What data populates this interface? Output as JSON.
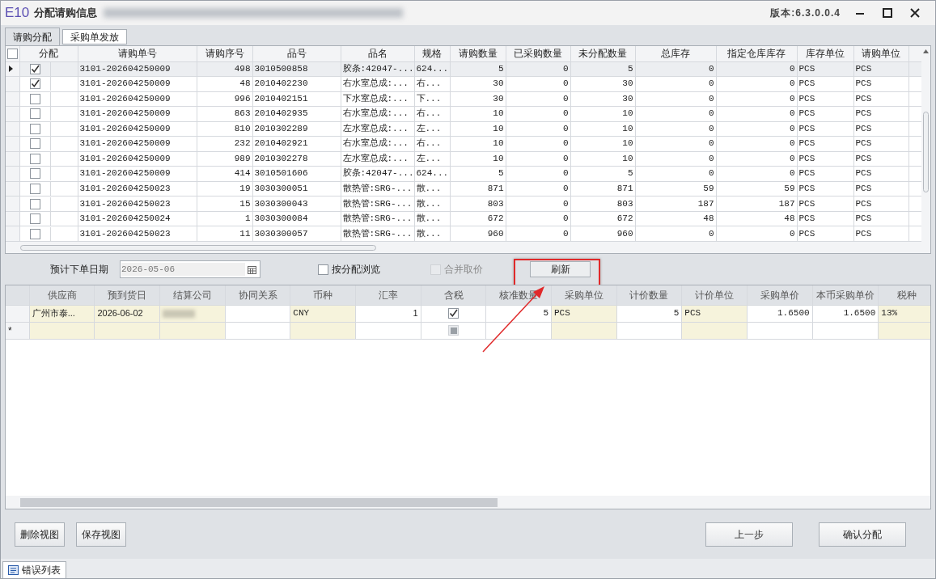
{
  "window": {
    "logo": "E10",
    "title": "分配请购信息",
    "version": "版本:6.3.0.0.4"
  },
  "tabs": [
    {
      "label": "请购分配",
      "selected": true
    },
    {
      "label": "采购单发放",
      "selected": false
    }
  ],
  "allocation_table": {
    "select_all_checked": false,
    "allocation_column": "分配",
    "columns": [
      "请购单号",
      "请购序号",
      "品号",
      "品名",
      "规格",
      "请购数量",
      "已采购数量",
      "未分配数量",
      "总库存",
      "指定仓库库存",
      "库存单位",
      "请购单位"
    ],
    "rows": [
      {
        "selected": true,
        "checked": true,
        "cells": [
          "3101-202604250009",
          "498",
          "3010500858",
          "胶条:42047-...",
          "624...",
          "5",
          "0",
          "5",
          "0",
          "0",
          "PCS",
          "PCS"
        ]
      },
      {
        "selected": false,
        "checked": true,
        "cells": [
          "3101-202604250009",
          "48",
          "2010402230",
          "右水室总成:...",
          "右...",
          "30",
          "0",
          "30",
          "0",
          "0",
          "PCS",
          "PCS"
        ]
      },
      {
        "selected": false,
        "checked": false,
        "cells": [
          "3101-202604250009",
          "996",
          "2010402151",
          "下水室总成:...",
          "下...",
          "30",
          "0",
          "30",
          "0",
          "0",
          "PCS",
          "PCS"
        ]
      },
      {
        "selected": false,
        "checked": false,
        "cells": [
          "3101-202604250009",
          "863",
          "2010402935",
          "右水室总成:...",
          "右...",
          "10",
          "0",
          "10",
          "0",
          "0",
          "PCS",
          "PCS"
        ]
      },
      {
        "selected": false,
        "checked": false,
        "cells": [
          "3101-202604250009",
          "810",
          "2010302289",
          "左水室总成:...",
          "左...",
          "10",
          "0",
          "10",
          "0",
          "0",
          "PCS",
          "PCS"
        ]
      },
      {
        "selected": false,
        "checked": false,
        "cells": [
          "3101-202604250009",
          "232",
          "2010402921",
          "右水室总成:...",
          "右...",
          "10",
          "0",
          "10",
          "0",
          "0",
          "PCS",
          "PCS"
        ]
      },
      {
        "selected": false,
        "checked": false,
        "cells": [
          "3101-202604250009",
          "989",
          "2010302278",
          "左水室总成:...",
          "左...",
          "10",
          "0",
          "10",
          "0",
          "0",
          "PCS",
          "PCS"
        ]
      },
      {
        "selected": false,
        "checked": false,
        "cells": [
          "3101-202604250009",
          "414",
          "3010501606",
          "胶条:42047-...",
          "624...",
          "5",
          "0",
          "5",
          "0",
          "0",
          "PCS",
          "PCS"
        ]
      },
      {
        "selected": false,
        "checked": false,
        "cells": [
          "3101-202604250023",
          "19",
          "3030300051",
          "散热管:SRG-...",
          "散...",
          "871",
          "0",
          "871",
          "59",
          "59",
          "PCS",
          "PCS"
        ]
      },
      {
        "selected": false,
        "checked": false,
        "cells": [
          "3101-202604250023",
          "15",
          "3030300043",
          "散热管:SRG-...",
          "散...",
          "803",
          "0",
          "803",
          "187",
          "187",
          "PCS",
          "PCS"
        ]
      },
      {
        "selected": false,
        "checked": false,
        "cells": [
          "3101-202604250024",
          "1",
          "3030300084",
          "散热管:SRG-...",
          "散...",
          "672",
          "0",
          "672",
          "48",
          "48",
          "PCS",
          "PCS"
        ]
      },
      {
        "selected": false,
        "checked": false,
        "cells": [
          "3101-202604250023",
          "11",
          "3030300057",
          "散热管:SRG-...",
          "散...",
          "960",
          "0",
          "960",
          "0",
          "0",
          "PCS",
          "PCS"
        ]
      }
    ]
  },
  "filters": {
    "date_label": "预计下单日期",
    "date_value": "2026-05-06",
    "options": [
      {
        "label": "按分配浏览",
        "checked": false,
        "disabled": false
      },
      {
        "label": "合并取价",
        "checked": false,
        "disabled": true
      }
    ],
    "refresh_button": "刷新"
  },
  "order_table": {
    "columns": [
      {
        "label": "供应商",
        "highlighted": true
      },
      {
        "label": "预到货日",
        "highlighted": true
      },
      {
        "label": "结算公司",
        "highlighted": true
      },
      {
        "label": "协同关系",
        "highlighted": false
      },
      {
        "label": "币种",
        "highlighted": true
      },
      {
        "label": "汇率",
        "highlighted": false
      },
      {
        "label": "含税",
        "highlighted": false
      },
      {
        "label": "核准数量",
        "highlighted": false
      },
      {
        "label": "采购单位",
        "highlighted": true
      },
      {
        "label": "计价数量",
        "highlighted": false
      },
      {
        "label": "计价单位",
        "highlighted": true
      },
      {
        "label": "采购单价",
        "highlighted": false
      },
      {
        "label": "本币采购单价",
        "highlighted": false
      },
      {
        "label": "税种",
        "highlighted": true
      }
    ],
    "rows": [
      {
        "kind": "data",
        "supplier": "广州市泰...",
        "arrival_date": "2026-06-02",
        "settlement_company_redacted": true,
        "currency": "CNY",
        "rate": "1",
        "tax_included": true,
        "approved_qty": "5",
        "purchase_unit": "PCS",
        "pricing_qty": "5",
        "pricing_unit": "PCS",
        "unit_price": "1.6500",
        "local_unit_price": "1.6500",
        "tax_type": "13%"
      },
      {
        "kind": "new",
        "indicator": "*"
      }
    ]
  },
  "buttons_left": [
    "删除视图",
    "保存视图"
  ],
  "buttons_right": [
    "上一步",
    "确认分配"
  ],
  "status_tab": "错误列表"
}
